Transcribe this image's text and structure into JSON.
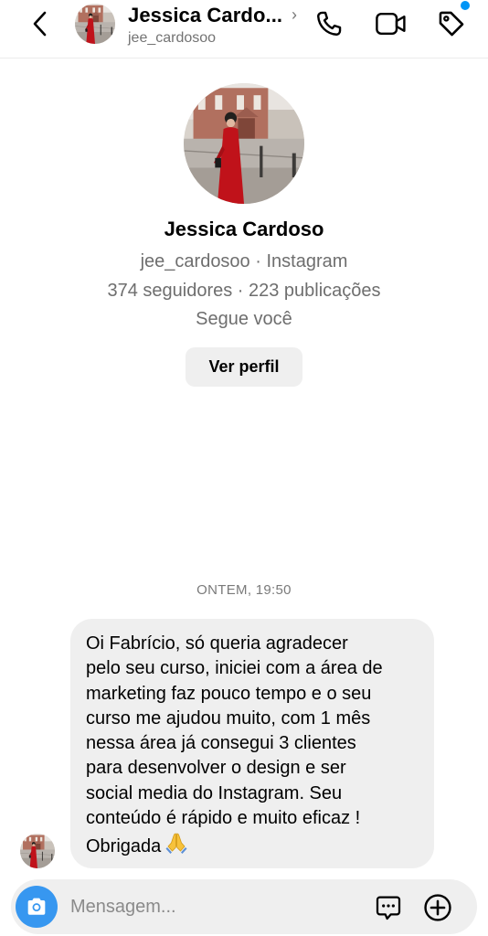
{
  "header": {
    "name": "Jessica Cardo...",
    "username": "jee_cardosoo",
    "chevron": "›",
    "icons": [
      "back-icon",
      "phone-icon",
      "video-icon",
      "tag-icon"
    ],
    "notification_dot_color": "#0095f6"
  },
  "profile": {
    "name": "Jessica Cardoso",
    "subtitle": "jee_cardosoo · Instagram",
    "stats": "374 seguidores · 223 publicações",
    "follow_status": "Segue você",
    "view_profile_label": "Ver perfil"
  },
  "conversation": {
    "timestamp": "ONTEM, 19:50",
    "messages": [
      {
        "lines": [
          "Oi Fabrício, só queria agradecer",
          "pelo seu curso, iniciei com a área de",
          "marketing faz pouco tempo e o seu",
          "curso me ajudou muito, com 1 mês",
          "nessa área já consegui 3 clientes",
          "para desenvolver o design e ser",
          "social media do Instagram. Seu",
          "conteúdo é rápido e muito eficaz !",
          "Obrigada"
        ],
        "emoji": "folded-hands-icon"
      }
    ]
  },
  "composer": {
    "placeholder": "Mensagem...",
    "camera_color": "#3797f0",
    "icons": [
      "camera-icon",
      "chat-bubble-icon",
      "add-circle-icon"
    ]
  }
}
